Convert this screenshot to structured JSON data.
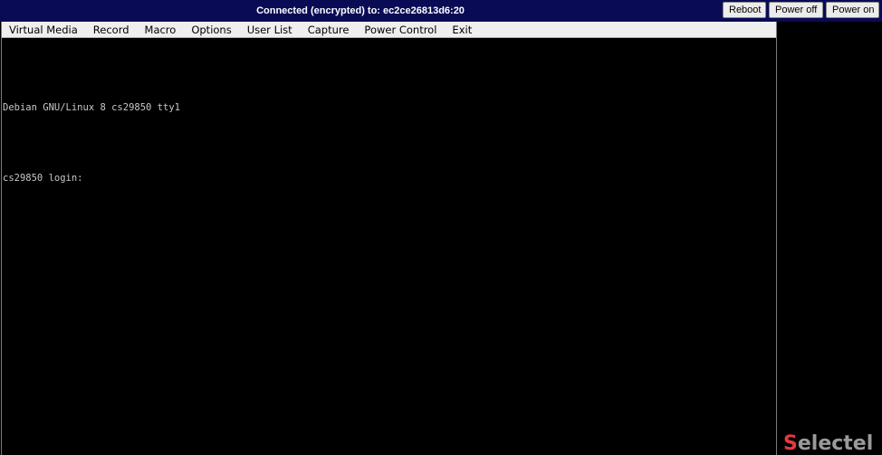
{
  "header": {
    "title": "Connected (encrypted) to: ec2ce26813d6:20",
    "buttons": {
      "reboot": "Reboot",
      "power_off": "Power off",
      "power_on": "Power on"
    }
  },
  "menu": {
    "items": [
      "Virtual Media",
      "Record",
      "Macro",
      "Options",
      "User List",
      "Capture",
      "Power Control",
      "Exit"
    ]
  },
  "terminal": {
    "lines": [
      "Debian GNU/Linux 8 cs29850 tty1",
      "cs29850 login:"
    ]
  },
  "brand": {
    "logo_text": "Selectel",
    "accent_color": "#e23b3b"
  },
  "colors": {
    "topbar": "#0a0b55",
    "menubar": "#efefef",
    "terminal_bg": "#000000",
    "terminal_fg": "#c8c8c8"
  }
}
